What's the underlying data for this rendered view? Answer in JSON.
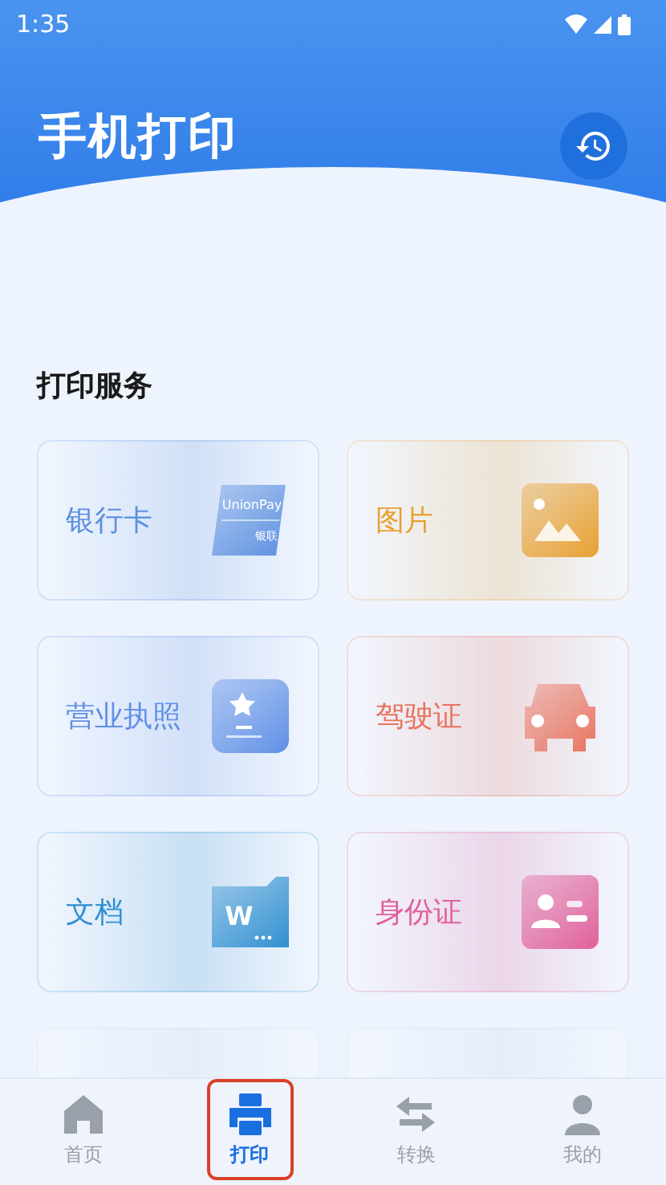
{
  "status_bar": {
    "time": "1:35"
  },
  "header": {
    "title": "手机打印"
  },
  "section": {
    "title": "打印服务"
  },
  "cards": [
    {
      "kind": "bank_card",
      "label": "银行卡",
      "color": "#5b8fe0",
      "icon_texts": [
        "UnionPay",
        "银联"
      ]
    },
    {
      "kind": "image",
      "label": "图片",
      "color": "#e8a030"
    },
    {
      "kind": "license",
      "label": "营业执照",
      "color": "#5f8fe6"
    },
    {
      "kind": "car",
      "label": "驾驶证",
      "color": "#e8735f"
    },
    {
      "kind": "document",
      "label": "文档",
      "color": "#2f8fd0",
      "icon_texts": [
        "W"
      ]
    },
    {
      "kind": "id_card",
      "label": "身份证",
      "color": "#e0609a"
    },
    {
      "kind": "hidden"
    },
    {
      "kind": "hidden"
    }
  ],
  "nav": [
    {
      "kind": "home",
      "label": "首页",
      "selected": false
    },
    {
      "kind": "print",
      "label": "打印",
      "selected": true
    },
    {
      "kind": "convert",
      "label": "转换",
      "selected": false
    },
    {
      "kind": "user",
      "label": "我的",
      "selected": false
    }
  ]
}
